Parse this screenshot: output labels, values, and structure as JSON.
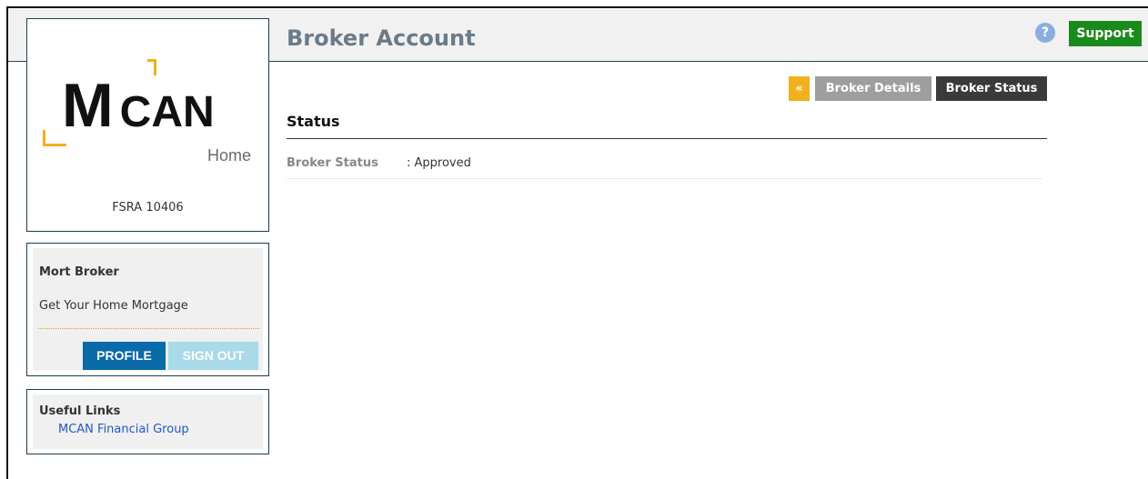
{
  "header": {
    "title": "Broker Account",
    "help_icon": "?",
    "support_label": "Support"
  },
  "logo": {
    "m": "M",
    "can": "CAN",
    "home": "Home",
    "fsra": "FSRA 10406"
  },
  "user": {
    "name": "Mort Broker",
    "tagline": "Get Your Home Mortgage",
    "profile_label": "PROFILE",
    "signout_label": "SIGN OUT"
  },
  "links": {
    "title": "Useful Links",
    "items": [
      {
        "label": "MCAN Financial Group"
      }
    ]
  },
  "tabs": {
    "back": "«",
    "details": "Broker Details",
    "status": "Broker Status"
  },
  "section": {
    "title": "Status",
    "fields": [
      {
        "label": "Broker Status",
        "value": ": Approved"
      }
    ]
  },
  "colors": {
    "accent_yellow": "#f2b01e",
    "support_green": "#1a8a1a",
    "profile_blue": "#0b6aa8",
    "signout_lightblue": "#a8daea",
    "tab_active": "#3a3a3a",
    "tab_inactive": "#9e9e9e",
    "link": "#2255cc"
  }
}
